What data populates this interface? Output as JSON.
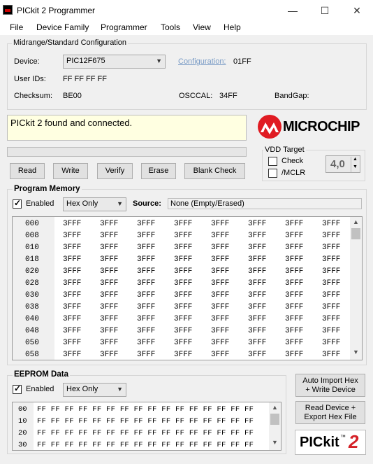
{
  "window": {
    "title": "PICkit 2 Programmer",
    "minimize": "—",
    "maximize": "☐",
    "close": "✕"
  },
  "menu": [
    "File",
    "Device Family",
    "Programmer",
    "Tools",
    "View",
    "Help"
  ],
  "config": {
    "group_title": "Midrange/Standard Configuration",
    "device_label": "Device:",
    "device_value": "PIC12F675",
    "configuration_link": "Configuration:",
    "configuration_value": "01FF",
    "user_ids_label": "User IDs:",
    "user_ids_value": "FF FF FF FF",
    "checksum_label": "Checksum:",
    "checksum_value": "BE00",
    "osccal_label": "OSCCAL:",
    "osccal_value": "34FF",
    "bandgap_label": "BandGap:",
    "bandgap_value": ""
  },
  "status": {
    "message": "PICkit 2 found and connected."
  },
  "logo": {
    "brand": "MICROCHIP"
  },
  "buttons": {
    "read": "Read",
    "write": "Write",
    "verify": "Verify",
    "erase": "Erase",
    "blank_check": "Blank Check"
  },
  "vdd": {
    "title": "VDD Target",
    "check_label": "Check",
    "mclr_label": "/MCLR",
    "voltage": "4,0",
    "check_checked": false,
    "mclr_checked": false
  },
  "program_memory": {
    "title": "Program Memory",
    "enabled_label": "Enabled",
    "enabled": true,
    "mode": "Hex Only",
    "source_label": "Source:",
    "source_value": "None (Empty/Erased)",
    "rows": [
      {
        "addr": "000",
        "cells": [
          "3FFF",
          "3FFF",
          "3FFF",
          "3FFF",
          "3FFF",
          "3FFF",
          "3FFF",
          "3FFF"
        ]
      },
      {
        "addr": "008",
        "cells": [
          "3FFF",
          "3FFF",
          "3FFF",
          "3FFF",
          "3FFF",
          "3FFF",
          "3FFF",
          "3FFF"
        ]
      },
      {
        "addr": "010",
        "cells": [
          "3FFF",
          "3FFF",
          "3FFF",
          "3FFF",
          "3FFF",
          "3FFF",
          "3FFF",
          "3FFF"
        ]
      },
      {
        "addr": "018",
        "cells": [
          "3FFF",
          "3FFF",
          "3FFF",
          "3FFF",
          "3FFF",
          "3FFF",
          "3FFF",
          "3FFF"
        ]
      },
      {
        "addr": "020",
        "cells": [
          "3FFF",
          "3FFF",
          "3FFF",
          "3FFF",
          "3FFF",
          "3FFF",
          "3FFF",
          "3FFF"
        ]
      },
      {
        "addr": "028",
        "cells": [
          "3FFF",
          "3FFF",
          "3FFF",
          "3FFF",
          "3FFF",
          "3FFF",
          "3FFF",
          "3FFF"
        ]
      },
      {
        "addr": "030",
        "cells": [
          "3FFF",
          "3FFF",
          "3FFF",
          "3FFF",
          "3FFF",
          "3FFF",
          "3FFF",
          "3FFF"
        ]
      },
      {
        "addr": "038",
        "cells": [
          "3FFF",
          "3FFF",
          "3FFF",
          "3FFF",
          "3FFF",
          "3FFF",
          "3FFF",
          "3FFF"
        ]
      },
      {
        "addr": "040",
        "cells": [
          "3FFF",
          "3FFF",
          "3FFF",
          "3FFF",
          "3FFF",
          "3FFF",
          "3FFF",
          "3FFF"
        ]
      },
      {
        "addr": "048",
        "cells": [
          "3FFF",
          "3FFF",
          "3FFF",
          "3FFF",
          "3FFF",
          "3FFF",
          "3FFF",
          "3FFF"
        ]
      },
      {
        "addr": "050",
        "cells": [
          "3FFF",
          "3FFF",
          "3FFF",
          "3FFF",
          "3FFF",
          "3FFF",
          "3FFF",
          "3FFF"
        ]
      },
      {
        "addr": "058",
        "cells": [
          "3FFF",
          "3FFF",
          "3FFF",
          "3FFF",
          "3FFF",
          "3FFF",
          "3FFF",
          "3FFF"
        ]
      }
    ]
  },
  "eeprom": {
    "title": "EEPROM Data",
    "enabled_label": "Enabled",
    "enabled": true,
    "mode": "Hex Only",
    "rows": [
      {
        "addr": "00",
        "cells": "FF FF FF FF FF FF FF FF FF FF FF FF FF FF FF FF"
      },
      {
        "addr": "10",
        "cells": "FF FF FF FF FF FF FF FF FF FF FF FF FF FF FF FF"
      },
      {
        "addr": "20",
        "cells": "FF FF FF FF FF FF FF FF FF FF FF FF FF FF FF FF"
      },
      {
        "addr": "30",
        "cells": "FF FF FF FF FF FF FF FF FF FF FF FF FF FF FF FF"
      }
    ]
  },
  "side_buttons": {
    "auto_import_line1": "Auto Import Hex",
    "auto_import_line2": "+ Write Device",
    "read_export_line1": "Read Device +",
    "read_export_line2": "Export Hex File"
  },
  "pickit_logo": {
    "text": "PICkit",
    "tm": "™",
    "num": "2"
  },
  "colors": {
    "link": "#7a9cc6",
    "status_bg": "#ffffe1",
    "logo_red": "#e01b22",
    "pickit_red": "#d42026"
  },
  "icons": {
    "app": "pickit-app-icon",
    "dropdown": "chevron-down-icon",
    "scroll_up": "scroll-up-icon",
    "scroll_down": "scroll-down-icon"
  }
}
